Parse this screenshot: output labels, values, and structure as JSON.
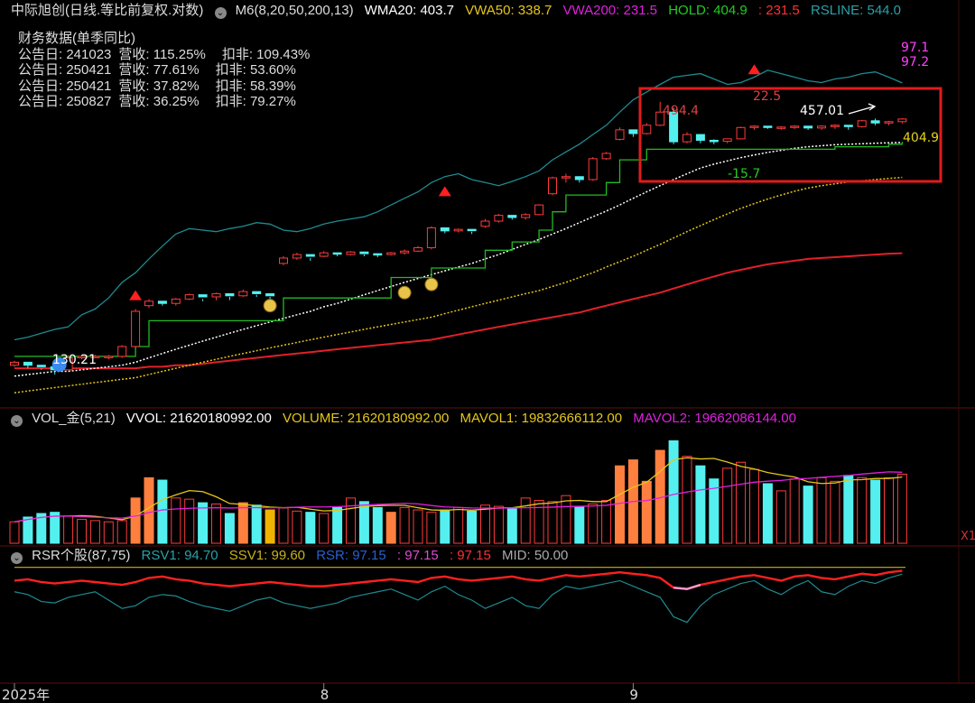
{
  "price_header": {
    "title": "中际旭创(日线.等比前复权.对数)",
    "icon": "chevron-down-circle-icon",
    "items": [
      {
        "text": "M6(8,20,50,200,13)",
        "color": "#dddddd"
      },
      {
        "text": "WMA20: 403.7",
        "color": "#ffffff"
      },
      {
        "text": "VWA50: 338.7",
        "color": "#e6c619"
      },
      {
        "text": "VWA200: 231.5",
        "color": "#e020e0"
      },
      {
        "text": "HOLD: 404.9",
        "color": "#22cc22"
      },
      {
        "text": ": 231.5",
        "color": "#ff3030"
      },
      {
        "text": "RSLINE: 544.0",
        "color": "#2aa0a8"
      }
    ]
  },
  "financial": {
    "title": "财务数据(单季同比)",
    "rows": [
      {
        "date": "公告日: 241023",
        "rev": "营收:  115.25%",
        "deduct": "扣非:  109.43%"
      },
      {
        "date": "公告日: 250421",
        "rev": "营收:  77.61%",
        "deduct": "扣非:  53.60%"
      },
      {
        "date": "公告日: 250421",
        "rev": "营收:  37.82%",
        "deduct": "扣非:  58.39%"
      },
      {
        "date": "公告日: 250827",
        "rev": "营收:  36.25%",
        "deduct": "扣非:  79.27%"
      }
    ]
  },
  "vol_header": {
    "icon": "chevron-down-circle-icon",
    "items": [
      {
        "text": "VOL_金(5,21)",
        "color": "#dddddd"
      },
      {
        "text": "VVOL: 21620180992.00",
        "color": "#ffffff"
      },
      {
        "text": "VOLUME: 21620180992.00",
        "color": "#e6c619"
      },
      {
        "text": "MAVOL1: 19832666112.00",
        "color": "#e6c619"
      },
      {
        "text": "MAVOL2: 19662086144.00",
        "color": "#e020e0"
      }
    ]
  },
  "rsr_header": {
    "icon": "chevron-down-circle-icon",
    "items": [
      {
        "text": "RSR个股(87,75)",
        "color": "#dddddd"
      },
      {
        "text": "RSV1: 94.70",
        "color": "#2aa0a8"
      },
      {
        "text": "SSV1: 99.60",
        "color": "#c8b21a"
      },
      {
        "text": "RSR: 97.15",
        "color": "#2a5fd0"
      },
      {
        "text": ": 97.15",
        "color": "#e04bd0"
      },
      {
        "text": ": 97.15",
        "color": "#ff3030"
      },
      {
        "text": "MID: 50.00",
        "color": "#aaaaaa"
      }
    ]
  },
  "annotations": {
    "low_label": "130.21",
    "top_right_1": "97.1",
    "top_right_2": "97.2",
    "box_high": "494.4",
    "box_high_b": "22.5",
    "box_mid": "457.01",
    "box_low": "-15.7",
    "hold_value": "404.9"
  },
  "axis": {
    "x_labels": [
      {
        "text": "2025年",
        "candle_index": 0
      },
      {
        "text": "8",
        "candle_index": 23
      },
      {
        "text": "9",
        "candle_index": 46
      }
    ],
    "vol_right_label": "X1"
  },
  "chart_data": {
    "type": "candlestick",
    "scale": "log",
    "series_names": [
      "WMA20",
      "VWA50",
      "VWA200",
      "HOLD",
      "RSLINE"
    ],
    "candles": [
      [
        132,
        135,
        131,
        134
      ],
      [
        134,
        133,
        130,
        132
      ],
      [
        132,
        130,
        129,
        131
      ],
      [
        131,
        128,
        126,
        129
      ],
      [
        129,
        138,
        129,
        137
      ],
      [
        137,
        139,
        136,
        138
      ],
      [
        138,
        139,
        137,
        138
      ],
      [
        138,
        139,
        136,
        138
      ],
      [
        138,
        146,
        137,
        145
      ],
      [
        145,
        175,
        144,
        173
      ],
      [
        178,
        184,
        176,
        182
      ],
      [
        182,
        181,
        178,
        180
      ],
      [
        180,
        185,
        178,
        184
      ],
      [
        184,
        189,
        183,
        188
      ],
      [
        188,
        184,
        182,
        186
      ],
      [
        186,
        190,
        183,
        189
      ],
      [
        189,
        186,
        183,
        187
      ],
      [
        187,
        193,
        186,
        191
      ],
      [
        191,
        188,
        186,
        189
      ],
      [
        189,
        186,
        184,
        187
      ],
      [
        220,
        228,
        218,
        226
      ],
      [
        226,
        232,
        224,
        230
      ],
      [
        230,
        226,
        223,
        228
      ],
      [
        228,
        234,
        227,
        232
      ],
      [
        232,
        230,
        228,
        231
      ],
      [
        230,
        234,
        229,
        233
      ],
      [
        233,
        230,
        228,
        231
      ],
      [
        231,
        229,
        227,
        230
      ],
      [
        230,
        233,
        229,
        232
      ],
      [
        232,
        236,
        230,
        234
      ],
      [
        234,
        240,
        233,
        238
      ],
      [
        238,
        265,
        236,
        263
      ],
      [
        263,
        260,
        256,
        259
      ],
      [
        259,
        262,
        257,
        261
      ],
      [
        261,
        258,
        255,
        260
      ],
      [
        265,
        275,
        263,
        272
      ],
      [
        272,
        282,
        270,
        280
      ],
      [
        280,
        278,
        274,
        277
      ],
      [
        277,
        283,
        274,
        281
      ],
      [
        281,
        296,
        280,
        295
      ],
      [
        312,
        340,
        310,
        338
      ],
      [
        338,
        345,
        330,
        340
      ],
      [
        340,
        336,
        330,
        335
      ],
      [
        335,
        375,
        333,
        372
      ],
      [
        372,
        385,
        370,
        382
      ],
      [
        410,
        435,
        408,
        430
      ],
      [
        430,
        425,
        415,
        422
      ],
      [
        422,
        445,
        420,
        440
      ],
      [
        440,
        495,
        438,
        470
      ],
      [
        470,
        480,
        400,
        405
      ],
      [
        405,
        425,
        402,
        420
      ],
      [
        420,
        416,
        402,
        408
      ],
      [
        408,
        410,
        400,
        406
      ],
      [
        406,
        412,
        402,
        411
      ],
      [
        411,
        437,
        410,
        435
      ],
      [
        435,
        440,
        430,
        438
      ],
      [
        438,
        436,
        432,
        435
      ],
      [
        435,
        438,
        430,
        436
      ],
      [
        436,
        440,
        432,
        438
      ],
      [
        438,
        436,
        430,
        434
      ],
      [
        434,
        440,
        430,
        438
      ],
      [
        438,
        442,
        432,
        440
      ],
      [
        440,
        438,
        430,
        437
      ],
      [
        437,
        452,
        435,
        450
      ],
      [
        450,
        455,
        440,
        445
      ],
      [
        445,
        450,
        440,
        448
      ],
      [
        448,
        456,
        444,
        454
      ]
    ],
    "wma20": [
      125,
      126,
      127,
      128,
      128,
      129,
      130,
      131,
      132,
      134,
      137,
      140,
      143,
      146,
      149,
      152,
      155,
      158,
      161,
      164,
      167,
      170,
      173,
      177,
      180,
      184,
      188,
      192,
      196,
      200,
      204,
      208,
      212,
      216,
      220,
      225,
      230,
      236,
      242,
      248,
      255,
      262,
      270,
      278,
      286,
      295,
      305,
      315,
      325,
      335,
      345,
      355,
      362,
      368,
      374,
      379,
      384,
      388,
      392,
      395,
      397,
      399,
      400,
      401,
      402,
      403,
      403.7
    ],
    "vwa50": [
      115,
      116,
      117,
      118,
      119,
      120,
      121,
      122,
      123,
      124,
      126,
      128,
      130,
      132,
      134,
      136,
      138,
      140,
      142,
      144,
      146,
      148,
      150,
      152,
      154,
      156,
      158,
      160,
      162,
      164,
      166,
      168,
      171,
      174,
      177,
      180,
      183,
      186,
      189,
      192,
      196,
      200,
      205,
      210,
      216,
      222,
      228,
      235,
      242,
      250,
      258,
      266,
      274,
      282,
      290,
      297,
      304,
      310,
      316,
      321,
      325,
      328,
      331,
      333,
      335,
      337,
      338.7
    ],
    "vwa200": [
      130,
      130,
      130,
      130,
      130,
      130,
      130,
      130,
      130,
      130,
      131,
      131,
      132,
      132,
      133,
      134,
      135,
      136,
      137,
      138,
      139,
      140,
      141,
      142,
      143,
      144,
      145,
      146,
      147,
      148,
      149,
      150,
      152,
      154,
      156,
      158,
      160,
      162,
      164,
      166,
      168,
      170,
      172,
      175,
      178,
      181,
      184,
      187,
      190,
      194,
      198,
      202,
      206,
      210,
      213,
      216,
      219,
      221,
      223,
      225,
      226,
      227,
      228,
      229,
      230,
      231,
      231.5
    ],
    "hold": [
      138,
      138,
      138,
      138,
      138,
      138,
      138,
      138,
      138,
      145,
      165,
      165,
      165,
      165,
      165,
      165,
      165,
      165,
      165,
      165,
      185,
      185,
      185,
      185,
      185,
      185,
      185,
      185,
      205,
      205,
      205,
      215,
      215,
      215,
      215,
      235,
      235,
      245,
      245,
      260,
      285,
      310,
      310,
      310,
      330,
      370,
      370,
      390,
      390,
      390,
      390,
      390,
      390,
      390,
      390,
      390,
      390,
      390,
      390,
      390,
      390,
      395,
      395,
      395,
      395,
      400,
      404.9
    ],
    "rsline": [
      150,
      152,
      155,
      158,
      160,
      170,
      175,
      185,
      200,
      210,
      225,
      240,
      255,
      262,
      260,
      258,
      262,
      265,
      270,
      268,
      260,
      258,
      262,
      268,
      272,
      275,
      278,
      285,
      295,
      305,
      315,
      330,
      340,
      345,
      335,
      330,
      325,
      332,
      340,
      350,
      370,
      385,
      400,
      420,
      440,
      470,
      500,
      520,
      540,
      560,
      565,
      570,
      555,
      540,
      545,
      560,
      580,
      570,
      560,
      550,
      545,
      555,
      560,
      570,
      575,
      560,
      544
    ],
    "volume_relative": [
      0.18,
      0.22,
      0.25,
      0.26,
      0.23,
      0.2,
      0.19,
      0.18,
      0.19,
      0.38,
      0.55,
      0.53,
      0.38,
      0.37,
      0.34,
      0.33,
      0.25,
      0.34,
      0.32,
      0.28,
      0.3,
      0.27,
      0.26,
      0.25,
      0.3,
      0.38,
      0.35,
      0.3,
      0.26,
      0.3,
      0.28,
      0.26,
      0.28,
      0.3,
      0.27,
      0.32,
      0.31,
      0.29,
      0.38,
      0.36,
      0.35,
      0.4,
      0.31,
      0.33,
      0.36,
      0.65,
      0.7,
      0.52,
      0.78,
      0.86,
      0.73,
      0.65,
      0.54,
      0.63,
      0.68,
      0.62,
      0.5,
      0.44,
      0.54,
      0.48,
      0.55,
      0.52,
      0.57,
      0.55,
      0.53,
      0.55,
      0.58
    ],
    "vol_orange_indices": [
      9,
      10,
      17,
      19,
      28,
      45,
      46,
      47,
      48
    ],
    "vol_yellow_indices": [
      19
    ],
    "rsr_ssv1_level": 99.6,
    "rsr_red": [
      90,
      91,
      89,
      88,
      89,
      90,
      89,
      88,
      87,
      89,
      92,
      93,
      91,
      90,
      88,
      87,
      86,
      87,
      88,
      89,
      88,
      87,
      86,
      86,
      87,
      88,
      89,
      90,
      91,
      90,
      89,
      92,
      93,
      91,
      90,
      91,
      92,
      93,
      91,
      90,
      92,
      94,
      93,
      94,
      95,
      96,
      95,
      94,
      92,
      85,
      84,
      87,
      89,
      91,
      93,
      94,
      92,
      90,
      93,
      94,
      92,
      91,
      93,
      95,
      94,
      96,
      97.15
    ],
    "rsr_rsv1": [
      82,
      80,
      75,
      74,
      78,
      80,
      82,
      76,
      70,
      72,
      78,
      80,
      79,
      75,
      72,
      70,
      68,
      72,
      76,
      78,
      74,
      72,
      70,
      72,
      74,
      78,
      80,
      82,
      84,
      80,
      76,
      82,
      86,
      80,
      76,
      70,
      74,
      78,
      72,
      70,
      80,
      86,
      84,
      86,
      88,
      90,
      86,
      82,
      78,
      64,
      60,
      72,
      80,
      84,
      88,
      90,
      84,
      80,
      86,
      90,
      82,
      80,
      86,
      90,
      88,
      92,
      94.7
    ]
  }
}
